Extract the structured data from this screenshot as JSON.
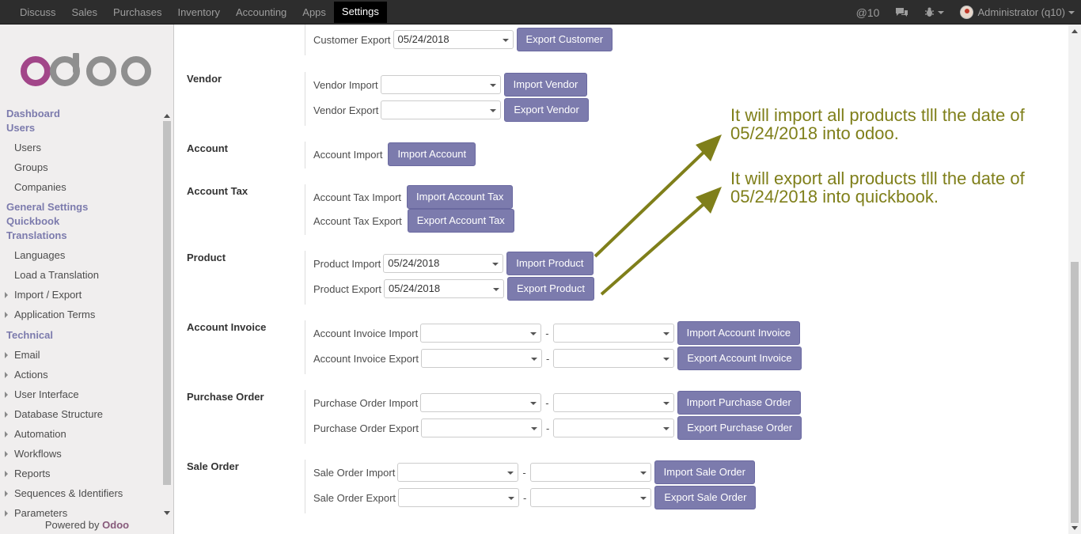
{
  "topbar": {
    "menu": [
      "Discuss",
      "Sales",
      "Purchases",
      "Inventory",
      "Accounting",
      "Apps",
      "Settings"
    ],
    "active": "Settings",
    "messages_count": "@10",
    "chat_icon": "chat-icon",
    "debug_icon": "bug-icon",
    "user": "Administrator (q10)"
  },
  "sidebar": {
    "logo_text": "odoo",
    "dashboard": "Dashboard",
    "users_head": "Users",
    "users_items": [
      "Users",
      "Groups",
      "Companies"
    ],
    "general_settings": "General Settings",
    "quickbook": "Quickbook",
    "translations": "Translations",
    "translation_items": [
      "Languages",
      "Load a Translation"
    ],
    "translation_tree": [
      "Import / Export",
      "Application Terms"
    ],
    "technical": "Technical",
    "technical_items": [
      "Email",
      "Actions",
      "User Interface",
      "Database Structure",
      "Automation",
      "Workflows",
      "Reports",
      "Sequences & Identifiers",
      "Parameters"
    ],
    "powered_prefix": "Powered by",
    "powered_brand": "Odoo"
  },
  "sections": {
    "customer": {
      "export_label": "Customer Export",
      "export_value": "05/24/2018",
      "export_btn": "Export Customer"
    },
    "vendor": {
      "title": "Vendor",
      "import_label": "Vendor Import",
      "import_value": "",
      "import_btn": "Import Vendor",
      "export_label": "Vendor Export",
      "export_value": "",
      "export_btn": "Export Vendor"
    },
    "account": {
      "title": "Account",
      "import_label": "Account Import",
      "import_btn": "Import Account"
    },
    "account_tax": {
      "title": "Account Tax",
      "import_label": "Account Tax Import",
      "import_btn": "Import Account Tax",
      "export_label": "Account Tax Export",
      "export_btn": "Export Account Tax"
    },
    "product": {
      "title": "Product",
      "import_label": "Product Import",
      "import_value": "05/24/2018",
      "import_btn": "Import Product",
      "export_label": "Product Export",
      "export_value": "05/24/2018",
      "export_btn": "Export Product"
    },
    "account_invoice": {
      "title": "Account Invoice",
      "import_label": "Account Invoice Import",
      "import_btn": "Import Account Invoice",
      "export_label": "Account Invoice Export",
      "export_btn": "Export Account Invoice",
      "separator": "-"
    },
    "purchase_order": {
      "title": "Purchase Order",
      "import_label": "Purchase Order Import",
      "import_btn": "Import Purchase Order",
      "export_label": "Purchase Order Export",
      "export_btn": "Export Purchase Order",
      "separator": "-"
    },
    "sale_order": {
      "title": "Sale Order",
      "import_label": "Sale Order Import",
      "import_btn": "Import Sale Order",
      "export_label": "Sale Order Export",
      "export_btn": "Export Sale Order",
      "separator": "-"
    }
  },
  "annotations": {
    "import_note_1": "It will import all products tlll the date of",
    "import_note_2": "05/24/2018 into odoo.",
    "export_note_1": "It will export all products tlll the date of",
    "export_note_2": "05/24/2018 into quickbook."
  },
  "colors": {
    "accent": "#7c7bad",
    "annotation": "#7f7f1a",
    "brand": "#875a7b"
  }
}
